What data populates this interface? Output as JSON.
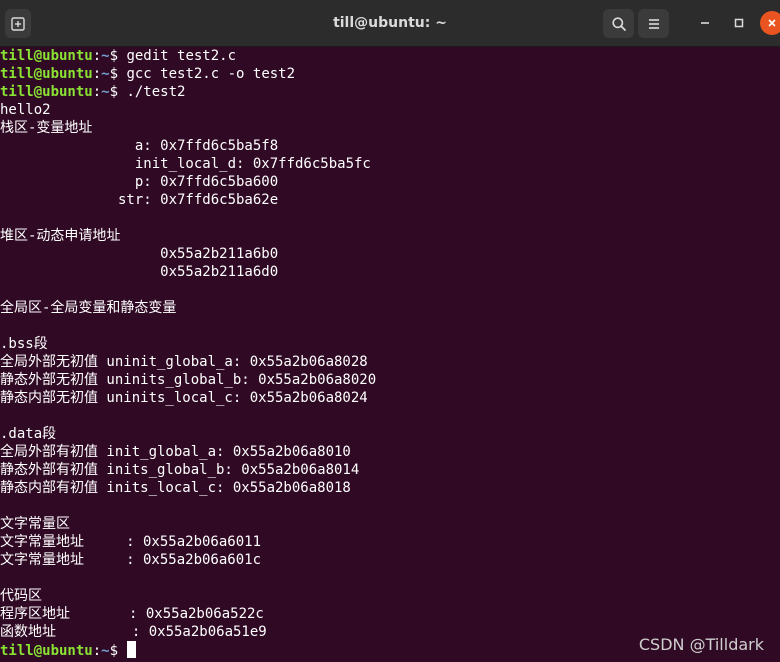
{
  "window": {
    "title": "till@ubuntu: ~",
    "buttons": {
      "new_tab_icon": "new-tab-icon",
      "search_icon": "search-icon",
      "menu_icon": "hamburger-menu-icon",
      "minimize_icon": "minimize-icon",
      "maximize_icon": "maximize-icon",
      "close_icon": "close-icon"
    }
  },
  "colors": {
    "background": "#300a24",
    "prompt_user": "#8ae234",
    "prompt_path": "#729fcf",
    "text": "#ffffff",
    "close_button": "#e95420"
  },
  "prompt": {
    "user": "till@ubuntu",
    "sep": ":",
    "path": "~",
    "dollar": "$ "
  },
  "commands": [
    "gedit test2.c",
    "gcc test2.c -o test2",
    "./test2"
  ],
  "output": [
    "hello2",
    "栈区-变量地址",
    "                a: 0x7ffd6c5ba5f8",
    "                init_local_d: 0x7ffd6c5ba5fc",
    "                p: 0x7ffd6c5ba600",
    "              str: 0x7ffd6c5ba62e",
    "",
    "堆区-动态申请地址",
    "                   0x55a2b211a6b0",
    "                   0x55a2b211a6d0",
    "",
    "全局区-全局变量和静态变量",
    "",
    ".bss段",
    "全局外部无初值 uninit_global_a: 0x55a2b06a8028",
    "静态外部无初值 uninits_global_b: 0x55a2b06a8020",
    "静态内部无初值 uninits_local_c: 0x55a2b06a8024",
    "",
    ".data段",
    "全局外部有初值 init_global_a: 0x55a2b06a8010",
    "静态外部有初值 inits_global_b: 0x55a2b06a8014",
    "静态内部有初值 inits_local_c: 0x55a2b06a8018",
    "",
    "文字常量区",
    "文字常量地址     : 0x55a2b06a6011",
    "文字常量地址     : 0x55a2b06a601c",
    "",
    "代码区",
    "程序区地址       : 0x55a2b06a522c",
    "函数地址         : 0x55a2b06a51e9"
  ],
  "watermark": "CSDN @Tilldark"
}
